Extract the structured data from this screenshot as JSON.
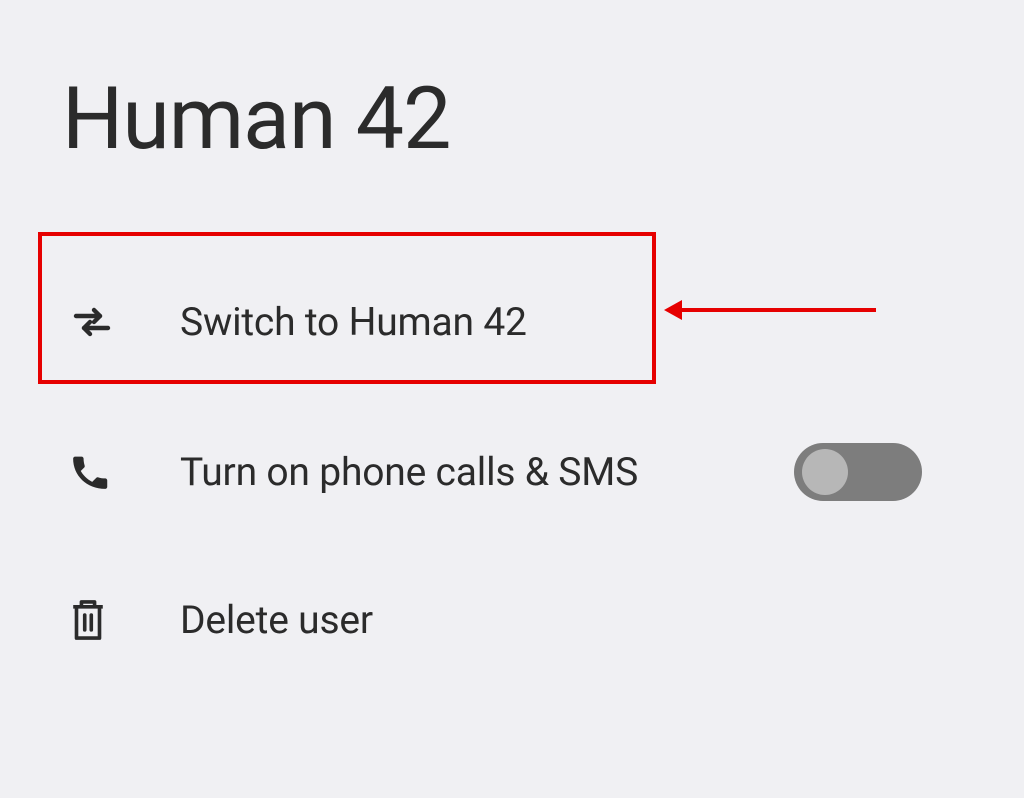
{
  "header": {
    "title": "Human 42"
  },
  "rows": {
    "switch": {
      "label": "Switch to Human 42",
      "icon": "swap-icon"
    },
    "phone": {
      "label": "Turn on phone calls & SMS",
      "icon": "phone-icon",
      "toggle": false
    },
    "delete": {
      "label": "Delete user",
      "icon": "trash-icon"
    }
  },
  "annotation": {
    "highlight": "switch",
    "arrow": true,
    "color": "#e60000"
  }
}
